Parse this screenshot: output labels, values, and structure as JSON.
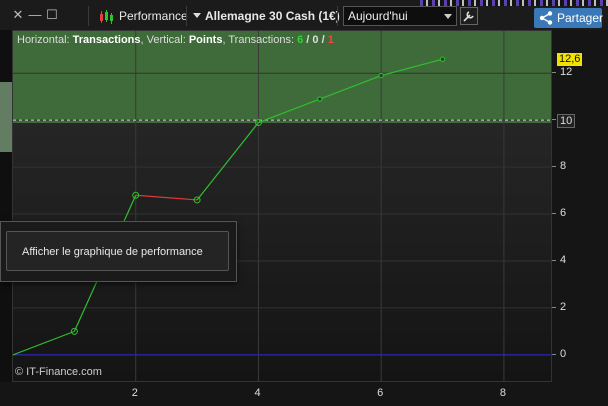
{
  "window": {
    "title_icon": "candlestick-chart-icon",
    "title": "Performance",
    "instrument": "Allemagne 30 Cash (1€)",
    "period": "Aujourd'hui",
    "share_label": "Partager"
  },
  "header": {
    "horizontal_label": "Horizontal:",
    "horizontal_value": "Transactions",
    "vertical_label": "Vertical:",
    "vertical_value": "Points",
    "transactions_label": "Transactions:",
    "wins": "6",
    "slash1": "/",
    "neutral": "0",
    "slash2": "/",
    "losses": "1"
  },
  "badges": {
    "current": "12,6",
    "reference": "10"
  },
  "tooltip": {
    "label": "Afficher le graphique de performance"
  },
  "watermark": "© IT-Finance.com",
  "colors": {
    "accent": "#3a78b8",
    "win_line": "#2fbf2f",
    "loss_line": "#e03a3a",
    "zone": "#3f6a3a",
    "zero_line": "#2a2ad0",
    "current_badge": "#f2e200"
  },
  "chart_data": {
    "type": "line",
    "title": "",
    "xlabel": "Transactions",
    "ylabel": "Points",
    "x_ticks": [
      "2",
      "4",
      "6",
      "8"
    ],
    "y_ticks": [
      "0",
      "2",
      "4",
      "6",
      "8",
      "10",
      "12"
    ],
    "xlim": [
      0,
      8.8
    ],
    "ylim": [
      -1.2,
      13.8
    ],
    "grid": true,
    "reference_level": 10,
    "points": [
      {
        "x": 0,
        "y": 0
      },
      {
        "x": 1,
        "y": 1
      },
      {
        "x": 2,
        "y": 6.8
      },
      {
        "x": 3,
        "y": 6.6
      },
      {
        "x": 4,
        "y": 9.9
      },
      {
        "x": 5,
        "y": 10.9
      },
      {
        "x": 6,
        "y": 11.9
      },
      {
        "x": 7,
        "y": 12.6
      }
    ],
    "losing_segments": [
      [
        2,
        3
      ]
    ]
  }
}
